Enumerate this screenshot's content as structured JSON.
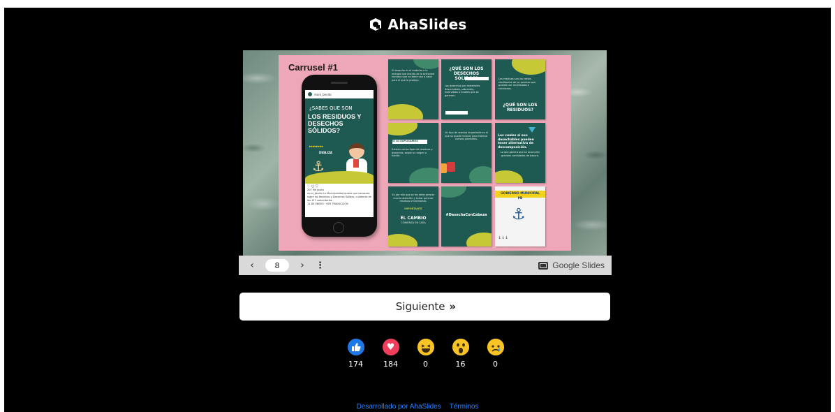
{
  "app": {
    "brand_name": "AhaSlides"
  },
  "slide": {
    "carousel_title": "Carrusel #1",
    "phone": {
      "profile_name": "muni_benito",
      "question": "¿SABES QUE SON",
      "headline": "LOS RESIDUOS Y DESECHOS SÓLIDOS?",
      "arrows": "▸▸▸▸▸▸▸▸",
      "swipe_label": "DESLIZA",
      "likes": "207 Me gusta",
      "caption": "muni_benito La Municipalidad quiere que conozcas sobre los Residuos y Desechos Sólidos, cuidemos de los 127 comentarios",
      "date": "11 DE ENERO · VER TRADUCCIÓN"
    },
    "tiles": [
      {
        "text": "El desecho es el material o la energía que resulta de la actividad humana que no tiene uso o valor para el que lo produjo."
      },
      {
        "heading": "¿QUÉ SON LOS DESECHOS SÓLIDOS?",
        "text": "Los desechos son materiales desechables, sobrantes, inservibles o inútiles que se generan."
      },
      {
        "text": "Los residuos son los restos resultantes de un proceso que pueden ser reutilizados o reciclados.",
        "heading": "¿QUÉ SON LOS RESIDUOS?"
      },
      {
        "label": "TE LO EXPLICAMOS",
        "text": "Existen varios tipos de residuos y desechos, según su origen o fuente."
      },
      {
        "text": "Un tipo de residuo importante es el que se puede reciclar para fabricar nuevos productos."
      },
      {
        "heading": "Los cuales si son desechables pueden tener alternativa de descomposición.",
        "text": "Lo que genera que se acumulen grandes cantidades de basura."
      },
      {
        "text": "Es por ello que se les debe prestar mucha atención y evitar generar residuos innecesarios.",
        "label": "IMPORTANTE",
        "heading": "EL CAMBIO",
        "sub": "COMIENZA EN CASA"
      },
      {
        "heading": "#DesechaConCabeza"
      },
      {
        "heading": "GOBIERNO MUNICIPAL PB"
      }
    ]
  },
  "slide_controls": {
    "prev_icon": "‹",
    "current_page": "8",
    "next_icon": "›",
    "more_icon": "⋮",
    "provider_label": "Google Slides"
  },
  "next_button": {
    "label": "Siguiente",
    "icon": "»"
  },
  "reactions": [
    {
      "name": "like",
      "icon": "thumbs-up-icon",
      "glyph": "👍",
      "count": "174"
    },
    {
      "name": "love",
      "icon": "heart-icon",
      "glyph": "♥",
      "count": "184"
    },
    {
      "name": "laugh",
      "icon": "laugh-face-icon",
      "glyph": "😆",
      "count": "0"
    },
    {
      "name": "wow",
      "icon": "wow-face-icon",
      "glyph": "😮",
      "count": "16"
    },
    {
      "name": "sad",
      "icon": "sad-face-icon",
      "glyph": "☹",
      "count": "0"
    }
  ],
  "footer": {
    "developed_by": "Desarrollado por AhaSlides",
    "terms": "Términos"
  },
  "colors": {
    "background": "#000000",
    "like": "#1e78e6",
    "love": "#ef3f5c",
    "emoji": "#f7c325",
    "link": "#2f84ff",
    "slide_pink": "#eea7b9",
    "slide_green": "#1e5a52"
  }
}
